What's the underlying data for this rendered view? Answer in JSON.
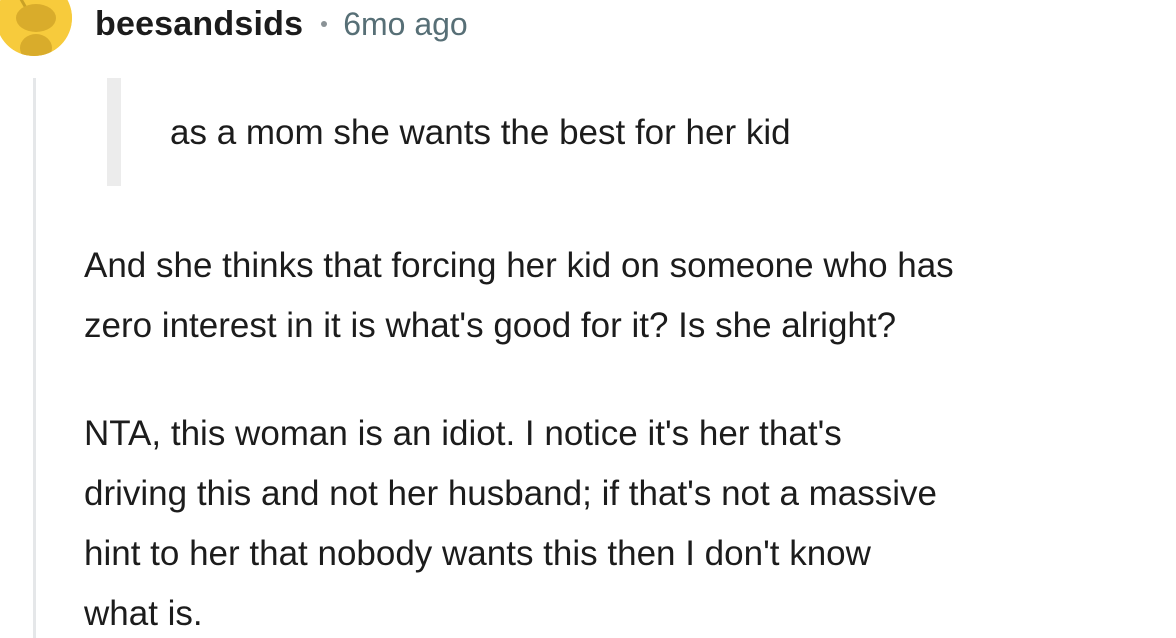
{
  "comment": {
    "username": "beesandsids",
    "timestamp": "6mo ago",
    "quote": "as a mom she wants the best for her kid",
    "paragraph1": [
      "And she thinks that forcing her kid on someone who has",
      "zero interest in it is what's good for it? Is she alright?"
    ],
    "paragraph2": [
      "NTA, this woman is an idiot. I notice it's her that's",
      "driving this and not her husband; if that's not a massive",
      "hint to her that nobody wants this then I don't know",
      "what is."
    ]
  },
  "icons": {
    "avatar": "snoo-avatar-icon"
  },
  "colors": {
    "avatar_bg": "#f7cb3c",
    "text": "#1c1c1c",
    "meta": "#576f76",
    "thread_line": "#e5e7e9",
    "quote_bar": "#ececec"
  }
}
